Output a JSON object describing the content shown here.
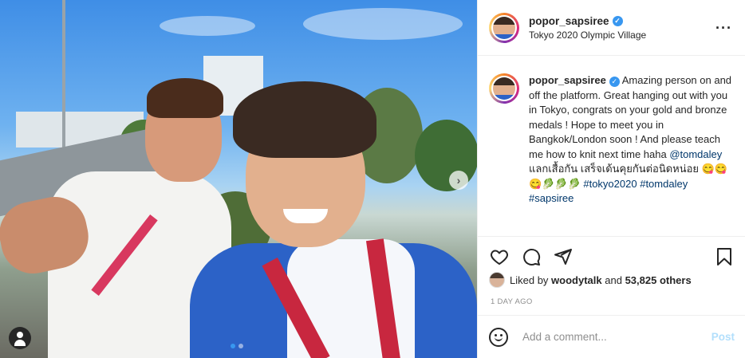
{
  "post": {
    "username": "popor_sapsiree",
    "location": "Tokyo 2020 Olympic Village",
    "caption": {
      "username": "popor_sapsiree",
      "text": " Amazing person on and off the platform. Great hanging out with you in Tokyo, congrats on your gold and bronze medals ! Hope to meet you in Bangkok/London soon ! And please teach me how to knit next time haha ",
      "mention": "@tomdaley",
      "thai_text": " แลกเสื้อกัน เสร็จเด้นคุยกันต่อนิดหน่อย 😋😋😋🥬🥬🥬 ",
      "hashtags": [
        "#tokyo2020",
        "#tomdaley",
        "#sapsiree"
      ]
    },
    "likes": {
      "prefix": "Liked by ",
      "liker": "woodytalk",
      "suffix": " and ",
      "others": "53,825 others"
    },
    "time": "1 DAY AGO",
    "comment_placeholder": "Add a comment...",
    "post_label": "Post",
    "carousel": {
      "current": 1,
      "total": 2
    }
  },
  "icons": {
    "more": "more-horizontal-icon",
    "like": "heart-icon",
    "comment": "comment-icon",
    "share": "paper-plane-icon",
    "save": "bookmark-icon",
    "emoji": "emoji-icon",
    "tag": "user-tag-icon",
    "next": "chevron-right-icon"
  },
  "colors": {
    "verified": "#3897f0",
    "hashtag": "#00376b",
    "post_button": "#b2dffc",
    "active_dot": "#3897f0"
  }
}
